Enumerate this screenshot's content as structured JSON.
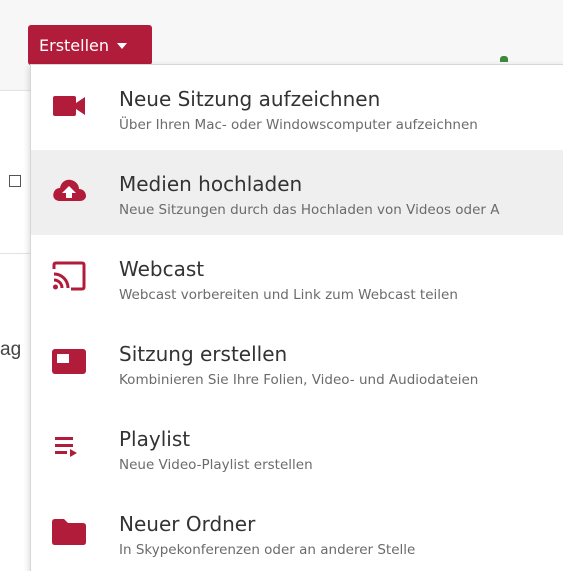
{
  "colors": {
    "accent": "#b11c3a",
    "hover_bg": "#efefef"
  },
  "create_button": {
    "label": "Erstellen"
  },
  "background": {
    "fragment_text": "ag"
  },
  "menu": {
    "items": [
      {
        "icon": "video-camera-icon",
        "title": "Neue Sitzung aufzeichnen",
        "desc": "Über Ihren Mac- oder Windowscomputer aufzeichnen"
      },
      {
        "icon": "cloud-upload-icon",
        "title": "Medien hochladen",
        "desc": "Neue Sitzungen durch das Hochladen von Videos oder A"
      },
      {
        "icon": "cast-icon",
        "title": "Webcast",
        "desc": "Webcast vorbereiten und Link zum Webcast teilen"
      },
      {
        "icon": "session-screen-icon",
        "title": "Sitzung erstellen",
        "desc": "Kombinieren Sie Ihre Folien, Video- und Audiodateien"
      },
      {
        "icon": "playlist-icon",
        "title": "Playlist",
        "desc": "Neue Video-Playlist erstellen"
      },
      {
        "icon": "folder-icon",
        "title": "Neuer Ordner",
        "desc": "In Skypekonferenzen oder an anderer Stelle"
      }
    ]
  }
}
